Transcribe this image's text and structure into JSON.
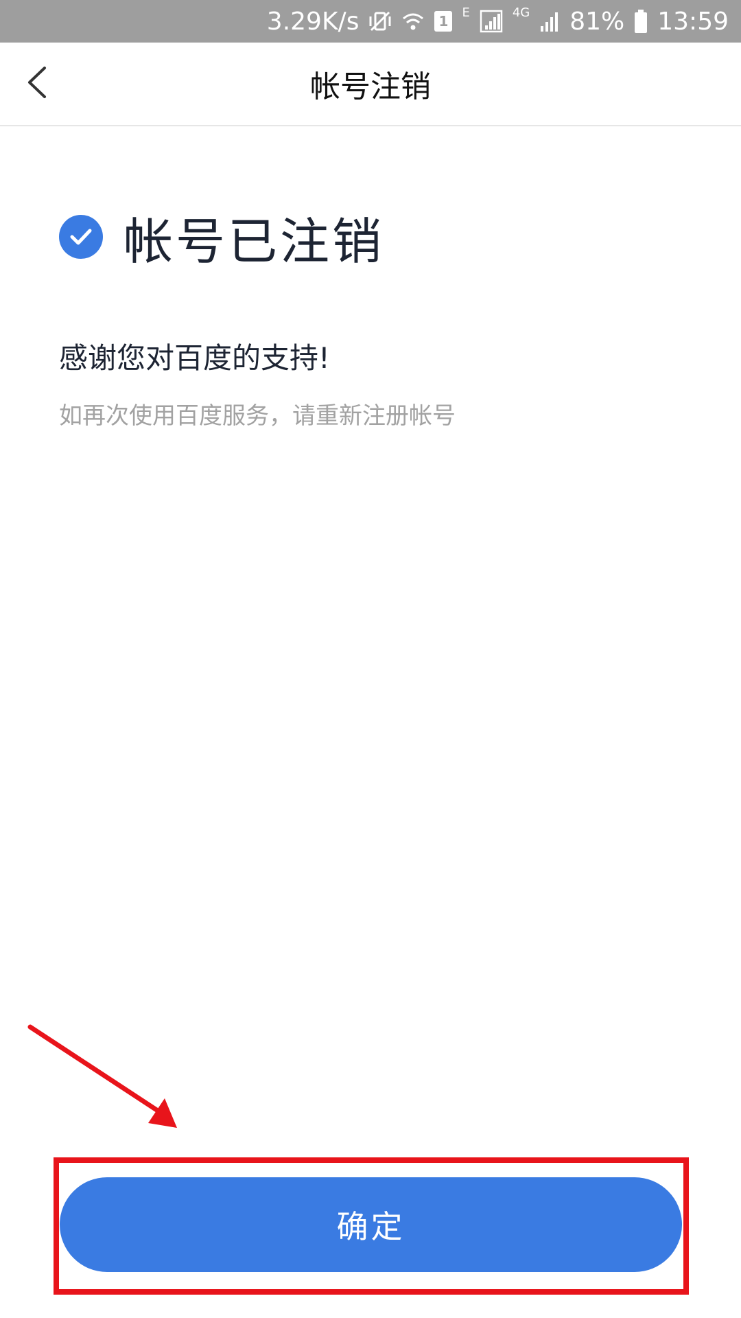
{
  "status_bar": {
    "speed": "3.29K/s",
    "sim_badge": "1",
    "network_e": "E",
    "network_4g": "4G",
    "battery": "81%",
    "time": "13:59",
    "icons": [
      "mute-vibrate-icon",
      "wifi-icon",
      "sim-icon",
      "signal-icon",
      "battery-icon"
    ]
  },
  "navbar": {
    "back_icon": "chevron-left-icon",
    "title": "帐号注销"
  },
  "content": {
    "status_icon": "check-circle-icon",
    "status_title": "帐号已注销",
    "thanks": "感谢您对百度的支持!",
    "hint": "如再次使用百度服务，请重新注册帐号"
  },
  "footer": {
    "confirm_label": "确定"
  },
  "colors": {
    "accent": "#3a7be2",
    "annotation": "#e8141b",
    "status_bar": "#9e9e9e"
  }
}
